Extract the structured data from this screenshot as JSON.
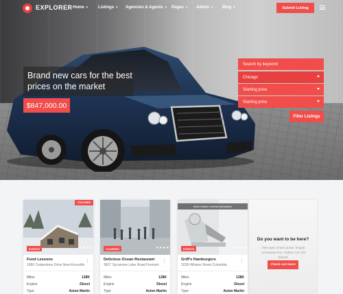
{
  "brand": {
    "name": "EXPLORER",
    "accent": "#f04d4b"
  },
  "nav": {
    "items": [
      {
        "label": "Home"
      },
      {
        "label": "Listings"
      },
      {
        "label": "Agencies & Agents"
      },
      {
        "label": "Pages"
      },
      {
        "label": "Admin"
      },
      {
        "label": "Blog"
      }
    ],
    "submit_label": "Submit Listing",
    "menu_icon": "hamburger-menu-icon"
  },
  "hero": {
    "headline": "Brand new cars for the best prices on the market",
    "price": "$847,000.00"
  },
  "search": {
    "keyword": "Search by keyword",
    "location": "Chicago",
    "start_price_1": "Starting price",
    "start_price_2": "Starting price",
    "filter_label": "Filter Listings"
  },
  "cards": [
    {
      "ribbon": "FEATURED",
      "badge": "EVENTS",
      "title": "Food Lessons",
      "address": "1890 Cedarstone Drive New Knoxville",
      "specs": [
        {
          "label": "Miles",
          "value": "128K"
        },
        {
          "label": "Engine",
          "value": "Diesel"
        },
        {
          "label": "Type",
          "value": "Aston Martin"
        }
      ]
    },
    {
      "badge": "COURSES",
      "title": "Delicious Ocean Restaurant",
      "address": "3827 Sycamore Lake Road Fremont",
      "specs": [
        {
          "label": "Miles",
          "value": "128K"
        },
        {
          "label": "Engine",
          "value": "Diesel"
        },
        {
          "label": "Type",
          "value": "Aston Martin"
        }
      ]
    },
    {
      "banner": "Most visited monthly translation",
      "badge": "EVENTS",
      "title": "Griff's Hamburgers",
      "address": "3228 Hillview Street Columbia",
      "specs": [
        {
          "label": "Miles",
          "value": "128K"
        },
        {
          "label": "Engine",
          "value": "Diesel"
        },
        {
          "label": "Type",
          "value": "Aston Martin"
        }
      ]
    }
  ],
  "cta": {
    "title": "Do you want to be here?",
    "text": "Duis eget ornare purus, feugiat consequat sem. Nullam non nisl blandit.",
    "button": "Check out more"
  }
}
